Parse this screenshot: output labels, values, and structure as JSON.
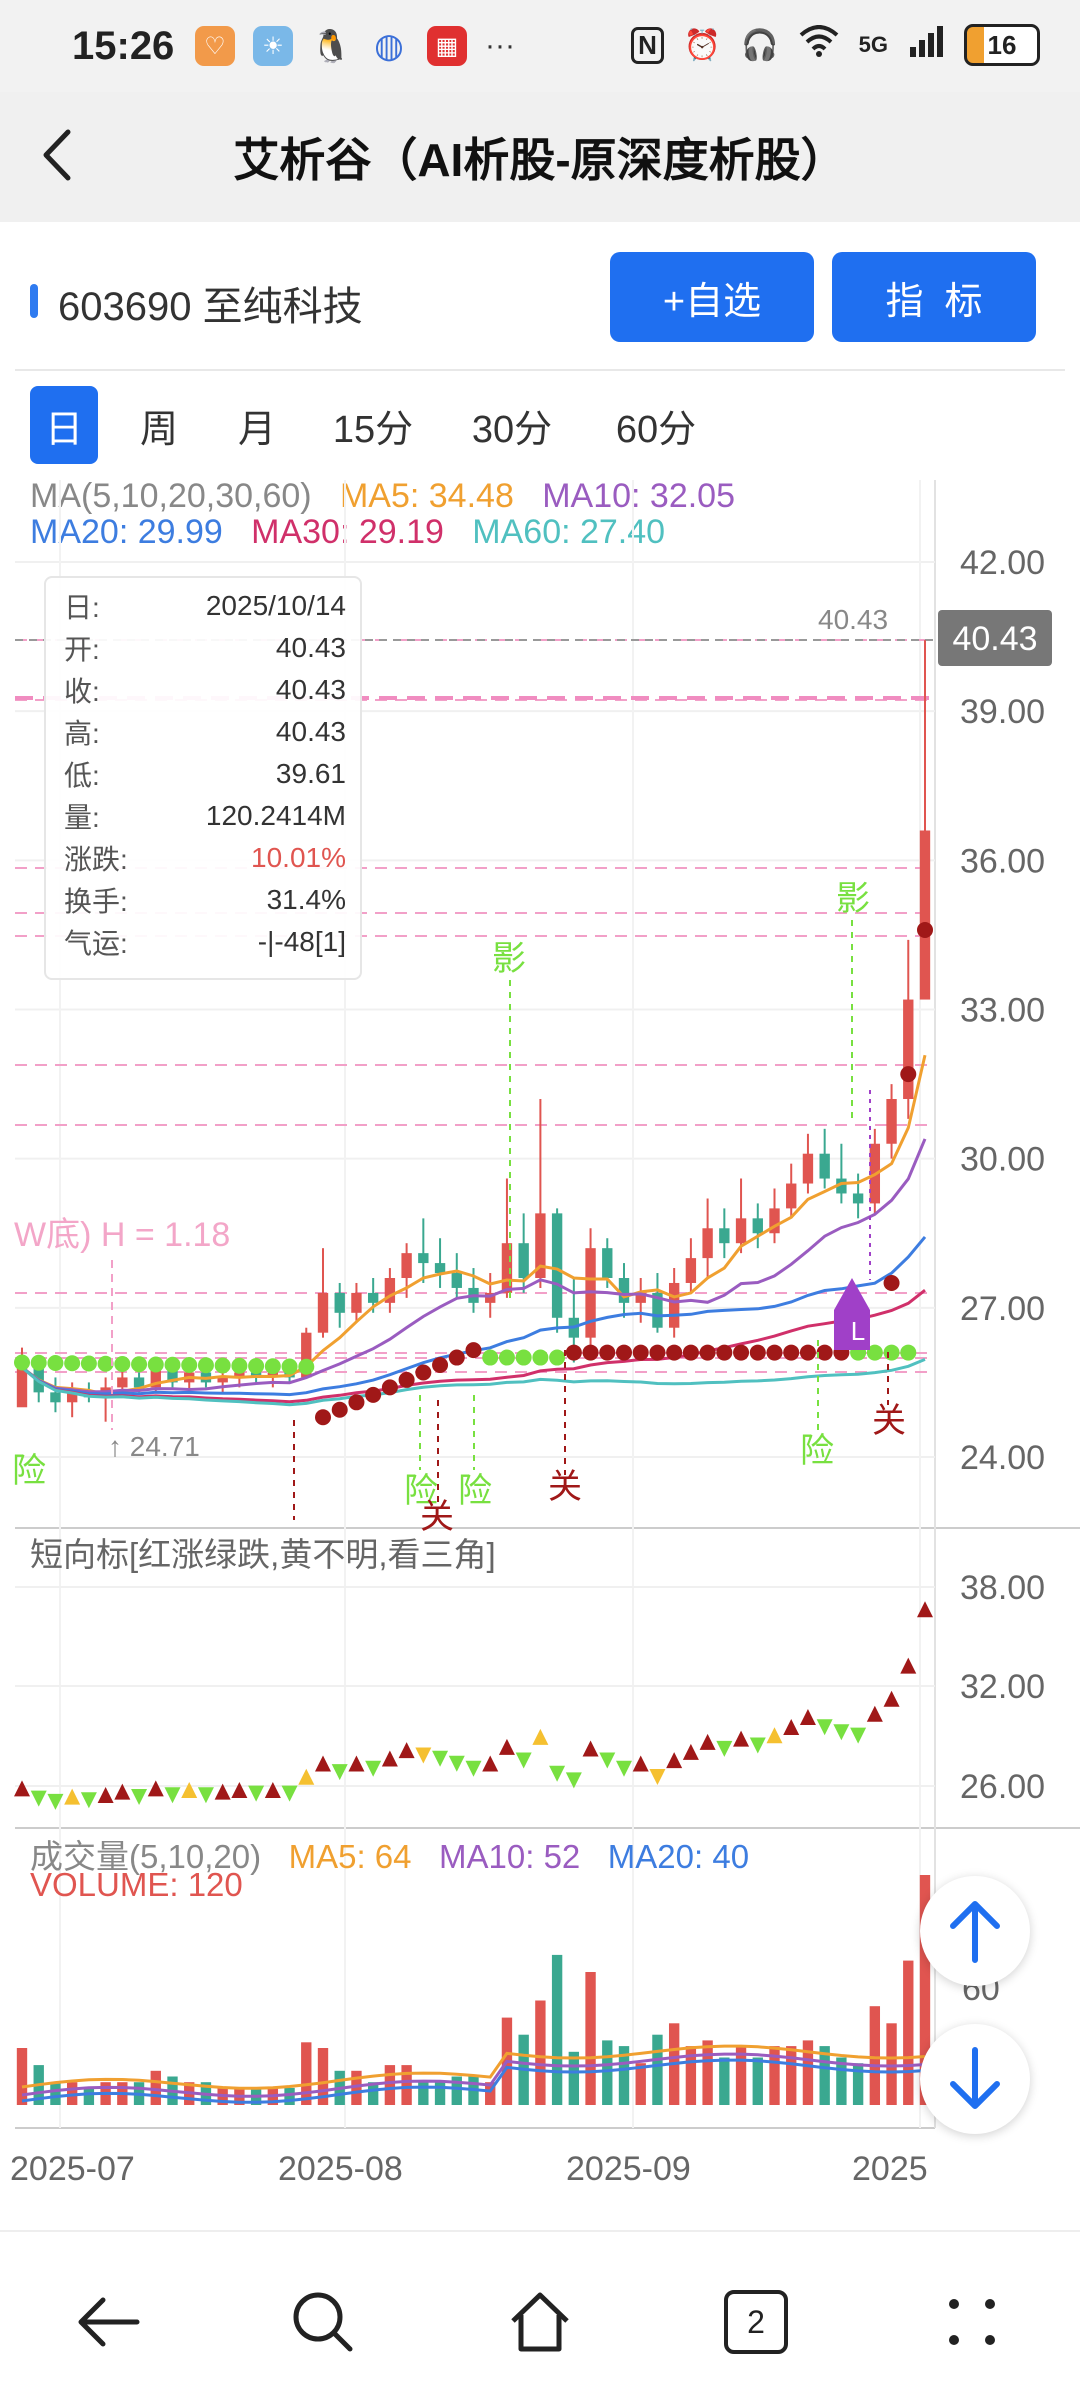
{
  "status_bar": {
    "time": "15:26",
    "network": "5G",
    "battery": "16",
    "app_icons": [
      "heart-app-icon",
      "weather-icon",
      "qq-icon",
      "browser-icon",
      "stock-app-icon"
    ],
    "more": "···",
    "right_icons": [
      "nfc-icon",
      "alarm-icon",
      "headphones-icon",
      "wifi-icon",
      "signal-icon",
      "battery-icon"
    ]
  },
  "header": {
    "title": "艾析谷（AI析股-原深度析股）",
    "back_icon": "chevron-left-icon"
  },
  "stock": {
    "label": "603690 至纯科技",
    "watchlist_button": "+自选",
    "indicator_button": "指  标"
  },
  "period_tabs": [
    {
      "label": "日",
      "active": true
    },
    {
      "label": "周",
      "active": false
    },
    {
      "label": "月",
      "active": false
    },
    {
      "label": "15分",
      "active": false
    },
    {
      "label": "30分",
      "active": false
    },
    {
      "label": "60分",
      "active": false
    }
  ],
  "ma_legend": {
    "ma_main": "MA(5,10,20,30,60)",
    "ma5": "MA5: 34.48",
    "ma10": "MA10: 32.05",
    "ma20": "MA20: 29.99",
    "ma30": "MA30: 29.19",
    "ma60": "MA60: 27.40"
  },
  "info_box": {
    "rows": [
      {
        "k": "日:",
        "v": "2025/10/14"
      },
      {
        "k": "开:",
        "v": "40.43"
      },
      {
        "k": "收:",
        "v": "40.43"
      },
      {
        "k": "高:",
        "v": "40.43"
      },
      {
        "k": "低:",
        "v": "39.61"
      },
      {
        "k": "量:",
        "v": "120.2414M"
      },
      {
        "k": "涨跌:",
        "v": "10.01%"
      },
      {
        "k": "换手:",
        "v": "31.4%"
      },
      {
        "k": "气运:",
        "v": "-|-48[1]"
      }
    ]
  },
  "main_chart": {
    "y_ticks": [
      "42.00",
      "39.00",
      "36.00",
      "33.00",
      "30.00",
      "27.00",
      "24.00"
    ],
    "price_tag": "40.43",
    "high_label": "40.43",
    "low_label": "24.71",
    "w_label": "W底) H = 1.18",
    "markers": [
      "影",
      "影",
      "险",
      "险",
      "险",
      "险",
      "关",
      "关",
      "关",
      "L"
    ]
  },
  "short_indicator": {
    "title": "短向标[红涨绿跌,黄不明,看三角]",
    "y_ticks": [
      "38.00",
      "32.00",
      "26.00"
    ]
  },
  "volume": {
    "title": "成交量(5,10,20)",
    "ma5": "MA5: 64",
    "ma10": "MA10: 52",
    "ma20": "MA20: 40",
    "volume_label": "VOLUME: 120",
    "y_tick": "60"
  },
  "x_axis": [
    "2025-07",
    "2025-08",
    "2025-09",
    "2025"
  ],
  "colors": {
    "accent": "#1f6ff0",
    "up": "#e05550",
    "down": "#3aa890",
    "ma5": "#f0a030",
    "ma10": "#9a5cc0",
    "ma20": "#3d7de0",
    "ma30": "#d0306a",
    "ma60": "#50c0c0",
    "dot_red": "#a01818",
    "dot_green": "#78e040",
    "marker_green": "#78e040",
    "marker_red": "#a01818"
  },
  "chart_data": {
    "type": "candlestick",
    "title": "603690 至纯科技",
    "period": "日",
    "y_range": [
      22.5,
      43.5
    ],
    "ohlc": [
      [
        25.0,
        26.2,
        25.2,
        25.8
      ],
      [
        25.8,
        25.9,
        25.1,
        25.3
      ],
      [
        25.3,
        25.6,
        24.9,
        25.1
      ],
      [
        25.1,
        25.5,
        24.8,
        25.3
      ],
      [
        25.3,
        25.5,
        25.1,
        25.2
      ],
      [
        25.2,
        25.6,
        24.71,
        25.4
      ],
      [
        25.4,
        25.8,
        25.2,
        25.6
      ],
      [
        25.6,
        25.7,
        25.3,
        25.4
      ],
      [
        25.4,
        25.9,
        25.3,
        25.8
      ],
      [
        25.8,
        26.0,
        25.4,
        25.5
      ],
      [
        25.5,
        25.8,
        25.3,
        25.7
      ],
      [
        25.7,
        25.9,
        25.4,
        25.5
      ],
      [
        25.5,
        25.8,
        25.3,
        25.6
      ],
      [
        25.6,
        25.8,
        25.4,
        25.7
      ],
      [
        25.7,
        25.9,
        25.5,
        25.6
      ],
      [
        25.6,
        25.8,
        25.4,
        25.7
      ],
      [
        25.7,
        25.8,
        25.5,
        25.6
      ],
      [
        25.6,
        26.6,
        25.6,
        26.5
      ],
      [
        26.5,
        28.2,
        26.4,
        27.3
      ],
      [
        27.3,
        27.5,
        26.6,
        26.9
      ],
      [
        26.9,
        27.5,
        26.7,
        27.3
      ],
      [
        27.3,
        27.6,
        26.9,
        27.1
      ],
      [
        27.1,
        27.8,
        26.9,
        27.6
      ],
      [
        27.6,
        28.3,
        27.2,
        28.1
      ],
      [
        28.1,
        28.8,
        27.5,
        27.9
      ],
      [
        27.9,
        28.4,
        27.4,
        27.7
      ],
      [
        27.7,
        28.1,
        27.2,
        27.4
      ],
      [
        27.4,
        27.8,
        26.9,
        27.1
      ],
      [
        27.1,
        27.7,
        26.8,
        27.3
      ],
      [
        27.3,
        29.6,
        27.2,
        28.3
      ],
      [
        28.3,
        28.9,
        27.3,
        27.6
      ],
      [
        27.6,
        31.2,
        27.4,
        28.9
      ],
      [
        28.9,
        29.0,
        26.5,
        26.8
      ],
      [
        26.8,
        27.6,
        25.9,
        26.4
      ],
      [
        26.4,
        28.6,
        26.2,
        28.2
      ],
      [
        28.2,
        28.4,
        27.4,
        27.6
      ],
      [
        27.6,
        27.9,
        26.8,
        27.1
      ],
      [
        27.1,
        27.6,
        26.7,
        27.3
      ],
      [
        27.3,
        27.7,
        26.5,
        26.6
      ],
      [
        26.6,
        27.8,
        26.4,
        27.5
      ],
      [
        27.5,
        28.4,
        27.3,
        28.0
      ],
      [
        28.0,
        29.2,
        27.6,
        28.6
      ],
      [
        28.6,
        29.0,
        28.0,
        28.3
      ],
      [
        28.3,
        29.6,
        28.1,
        28.8
      ],
      [
        28.8,
        29.1,
        28.2,
        28.5
      ],
      [
        28.5,
        29.4,
        28.3,
        29.0
      ],
      [
        29.0,
        29.9,
        28.8,
        29.5
      ],
      [
        29.5,
        30.5,
        29.3,
        30.1
      ],
      [
        30.1,
        30.6,
        29.4,
        29.6
      ],
      [
        29.6,
        30.3,
        29.1,
        29.3
      ],
      [
        29.3,
        29.7,
        28.8,
        29.1
      ],
      [
        29.1,
        30.6,
        28.9,
        30.3
      ],
      [
        30.3,
        31.5,
        30.0,
        31.2
      ],
      [
        31.2,
        34.4,
        30.8,
        33.2
      ],
      [
        33.2,
        36.6,
        40.43,
        36.6
      ]
    ]
  }
}
